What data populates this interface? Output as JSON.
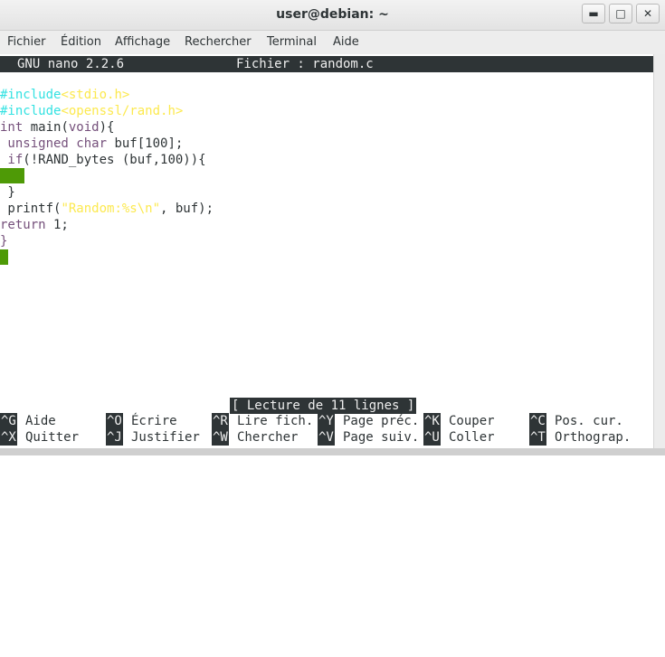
{
  "window": {
    "title": "user@debian: ~",
    "buttons": [
      "▬",
      "□",
      "✕"
    ]
  },
  "menubar": [
    "Fichier",
    "Édition",
    "Affichage",
    "Rechercher",
    "Terminal",
    "Aide"
  ],
  "nano": {
    "version": "GNU nano 2.2.6",
    "file_label": "Fichier : random.c",
    "status": "[ Lecture de 11 lignes ]"
  },
  "code": {
    "l1_pp": "#include",
    "l1_inc": "<stdio.h>",
    "l2_pp": "#include",
    "l2_inc": "<openssl/rand.h>",
    "l3_kw": "int",
    "l3_rest": " main(",
    "l3_kw2": "void",
    "l3_end": "){",
    "l4_kw": " unsigned char",
    "l4_rest": " buf[100];",
    "l5_kw": " if",
    "l5_rest": "(!RAND_bytes (buf,100)){",
    "l7": " }",
    "l8_start": " printf(",
    "l8_str": "\"Random:%s\\n\"",
    "l8_end": ", buf);",
    "l9_kw": "return",
    "l9_rest": " 1;",
    "l10_kw": "}"
  },
  "shortcuts": {
    "row1": [
      {
        "key": "^G",
        "label": "Aide"
      },
      {
        "key": "^O",
        "label": "Écrire"
      },
      {
        "key": "^R",
        "label": "Lire fich."
      },
      {
        "key": "^Y",
        "label": "Page préc."
      },
      {
        "key": "^K",
        "label": "Couper"
      },
      {
        "key": "^C",
        "label": "Pos. cur."
      }
    ],
    "row2": [
      {
        "key": "^X",
        "label": "Quitter"
      },
      {
        "key": "^J",
        "label": "Justifier"
      },
      {
        "key": "^W",
        "label": "Chercher"
      },
      {
        "key": "^V",
        "label": "Page suiv."
      },
      {
        "key": "^U",
        "label": "Coller"
      },
      {
        "key": "^T",
        "label": "Orthograp."
      }
    ]
  }
}
